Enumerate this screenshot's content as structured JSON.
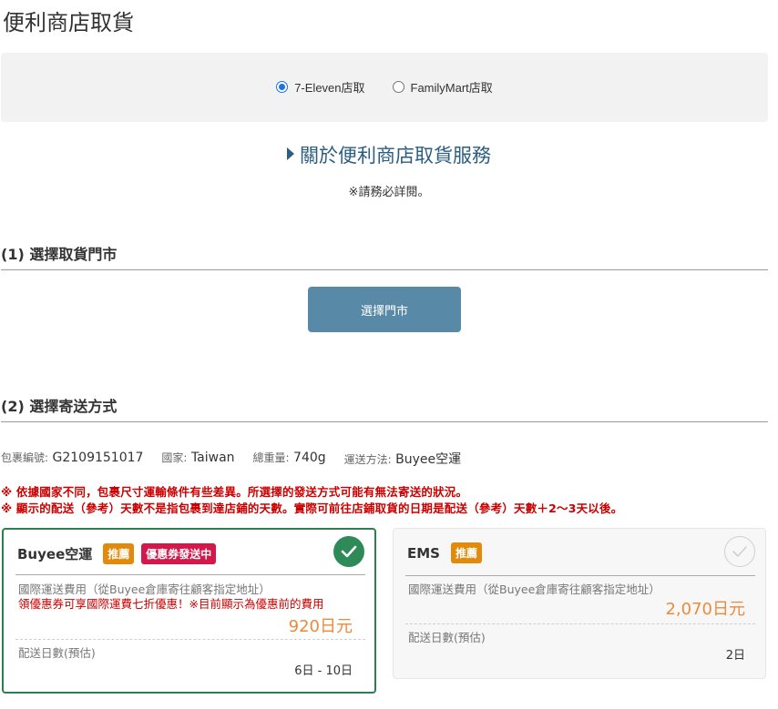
{
  "page": {
    "title": "便利商店取貨"
  },
  "store_options": [
    {
      "label": "7-Eleven店取",
      "selected": true
    },
    {
      "label": "FamilyMart店取",
      "selected": false
    }
  ],
  "about": {
    "link": "關於便利商店取貨服務",
    "note": "※請務必詳閱。"
  },
  "section1": {
    "title": "(1) 選擇取貨門市",
    "button": "選擇門市"
  },
  "section2": {
    "title": "(2) 選擇寄送方式"
  },
  "package": {
    "id_label": "包裹編號:",
    "id": "G2109151017",
    "country_label": "國家:",
    "country": "Taiwan",
    "weight_label": "總重量:",
    "weight": "740g",
    "method_label": "運送方法:",
    "method": "Buyee空運"
  },
  "warnings": [
    "※ 依據國家不同，包裹尺寸運輸條件有些差異。所選擇的發送方式可能有無法寄送的狀況。",
    "※ 顯示的配送（參考）天數不是指包裹到達店鋪的天數。實際可前往店鋪取貨的日期是配送（參考）天數＋2～3天以後。"
  ],
  "shipping_options": [
    {
      "name": "Buyee空運",
      "badges": [
        "推薦",
        "優惠券發送中"
      ],
      "selected": true,
      "fee_label": "國際運送費用（從Buyee倉庫寄往顧客指定地址）",
      "promo_note": "領優惠券可享國際運費七折優惠！※目前顯示為優惠前的費用",
      "price": "920日元",
      "days_label": "配送日數(預估)",
      "days": "6日 - 10日"
    },
    {
      "name": "EMS",
      "badges": [
        "推薦"
      ],
      "selected": false,
      "fee_label": "國際運送費用（從Buyee倉庫寄往顧客指定地址）",
      "price": "2,070日元",
      "days_label": "配送日數(預估)",
      "days": "2日"
    }
  ],
  "colors": {
    "accent_blue": "#2b5e82",
    "button": "#5889a6",
    "selected_border": "#2e7d4f",
    "warning_red": "#cc0000",
    "price_orange": "#ec8a3c",
    "badge_orange": "#e28a0c",
    "badge_red": "#d4184b"
  }
}
